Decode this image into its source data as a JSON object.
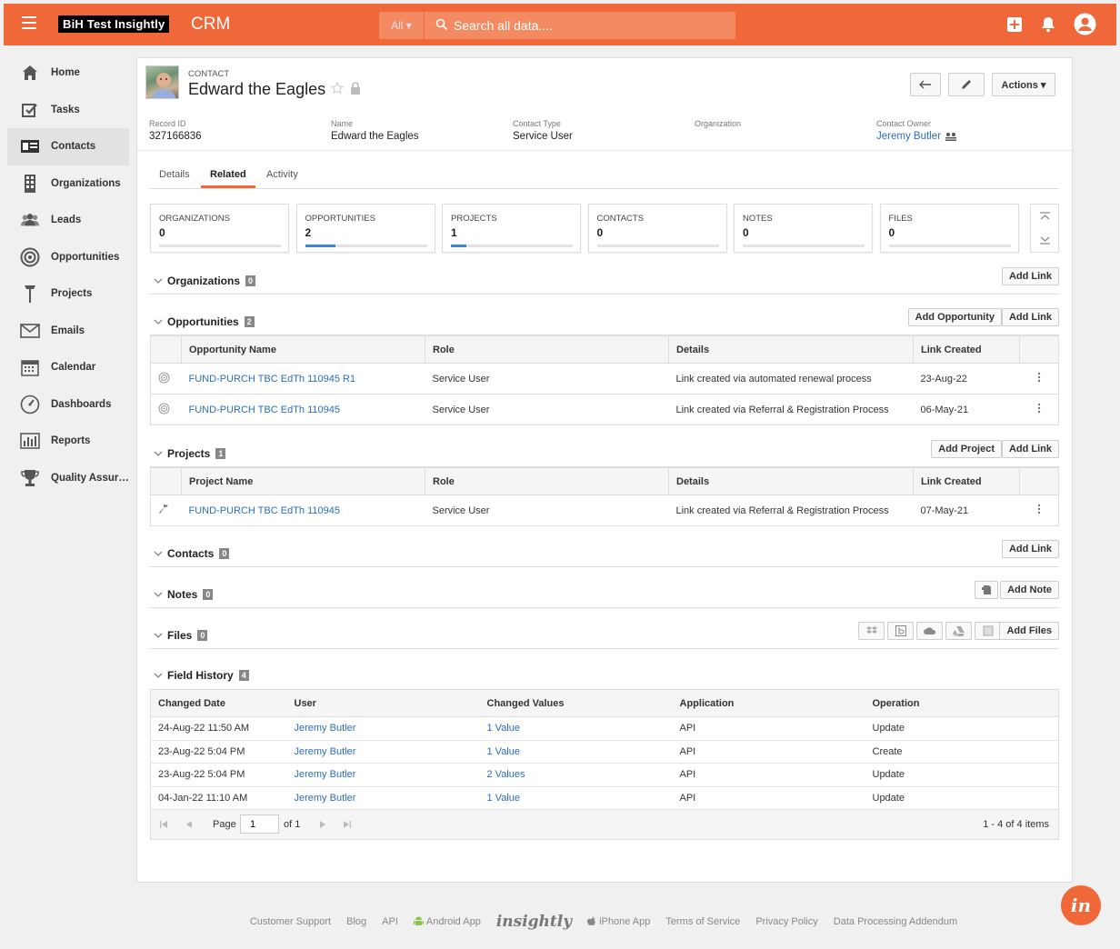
{
  "topbar": {
    "brand": "BiH Test Insightly",
    "app": "CRM",
    "search_scope": "All ▾",
    "search_placeholder": "Search all data...."
  },
  "sidebar": {
    "items": [
      {
        "label": "Home",
        "icon": "home-icon"
      },
      {
        "label": "Tasks",
        "icon": "tasks-icon"
      },
      {
        "label": "Contacts",
        "icon": "contacts-icon"
      },
      {
        "label": "Organizations",
        "icon": "organizations-icon"
      },
      {
        "label": "Leads",
        "icon": "leads-icon"
      },
      {
        "label": "Opportunities",
        "icon": "opportunities-icon"
      },
      {
        "label": "Projects",
        "icon": "projects-icon"
      },
      {
        "label": "Emails",
        "icon": "emails-icon"
      },
      {
        "label": "Calendar",
        "icon": "calendar-icon"
      },
      {
        "label": "Dashboards",
        "icon": "dashboards-icon"
      },
      {
        "label": "Reports",
        "icon": "reports-icon"
      },
      {
        "label": "Quality Assura...",
        "icon": "trophy-icon"
      }
    ],
    "active": "Contacts"
  },
  "record": {
    "type": "CONTACT",
    "name": "Edward the Eagles",
    "actions_label": "Actions ▾",
    "fields": [
      {
        "label": "Record ID",
        "value": "327166836"
      },
      {
        "label": "Name",
        "value": "Edward the Eagles"
      },
      {
        "label": "Contact Type",
        "value": "Service User"
      },
      {
        "label": "Organization",
        "value": ""
      },
      {
        "label": "Contact Owner",
        "value": "Jeremy Butler"
      }
    ]
  },
  "tabs": [
    "Details",
    "Related",
    "Activity"
  ],
  "active_tab": "Related",
  "cards": [
    {
      "label": "ORGANIZATIONS",
      "count": "0",
      "fill": 0
    },
    {
      "label": "OPPORTUNITIES",
      "count": "2",
      "fill": 0.25
    },
    {
      "label": "PROJECTS",
      "count": "1",
      "fill": 0.13
    },
    {
      "label": "CONTACTS",
      "count": "0",
      "fill": 0
    },
    {
      "label": "NOTES",
      "count": "0",
      "fill": 0
    },
    {
      "label": "FILES",
      "count": "0",
      "fill": 0
    }
  ],
  "sections": {
    "organizations": {
      "title": "Organizations",
      "count": "0",
      "add_link": "Add Link"
    },
    "opportunities": {
      "title": "Opportunities",
      "count": "2",
      "add_primary": "Add Opportunity",
      "add_link": "Add Link",
      "headers": [
        "Opportunity Name",
        "Role",
        "Details",
        "Link Created"
      ],
      "rows": [
        {
          "name": "FUND-PURCH TBC EdTh 110945 R1",
          "role": "Service User",
          "details": "Link created via automated renewal process",
          "created": "23-Aug-22"
        },
        {
          "name": "FUND-PURCH TBC EdTh 110945",
          "role": "Service User",
          "details": "Link created via Referral & Registration Process",
          "created": "06-May-21"
        }
      ]
    },
    "projects": {
      "title": "Projects",
      "count": "1",
      "add_primary": "Add Project",
      "add_link": "Add Link",
      "headers": [
        "Project Name",
        "Role",
        "Details",
        "Link Created"
      ],
      "rows": [
        {
          "name": "FUND-PURCH TBC EdTh 110945",
          "role": "Service User",
          "details": "Link created via Referral & Registration Process",
          "created": "07-May-21"
        }
      ]
    },
    "contacts": {
      "title": "Contacts",
      "count": "0",
      "add_link": "Add Link"
    },
    "notes": {
      "title": "Notes",
      "count": "0",
      "add_note": "Add Note"
    },
    "files": {
      "title": "Files",
      "count": "0",
      "add_files": "Add Files"
    },
    "history": {
      "title": "Field History",
      "count": "4",
      "headers": [
        "Changed Date",
        "User",
        "Changed Values",
        "Application",
        "Operation"
      ],
      "rows": [
        {
          "date": "24-Aug-22 11:50 AM",
          "user": "Jeremy Butler",
          "values": "1 Value",
          "app": "API",
          "op": "Update"
        },
        {
          "date": "23-Aug-22 5:04 PM",
          "user": "Jeremy Butler",
          "values": "1 Value",
          "app": "API",
          "op": "Create"
        },
        {
          "date": "23-Aug-22 5:04 PM",
          "user": "Jeremy Butler",
          "values": "2 Values",
          "app": "API",
          "op": "Update"
        },
        {
          "date": "04-Jan-22 11:10 AM",
          "user": "Jeremy Butler",
          "values": "1 Value",
          "app": "API",
          "op": "Update"
        }
      ],
      "page_label": "Page",
      "page_value": "1",
      "page_of": "of 1",
      "items_summary": "1 - 4 of 4 items"
    }
  },
  "footer": {
    "links": [
      "Customer Support",
      "Blog",
      "API",
      "Android App",
      "iPhone App",
      "Terms of Service",
      "Privacy Policy",
      "Data Processing Addendum"
    ],
    "logo": "insightly"
  },
  "badge": "in",
  "colors": {
    "brand": "#f0673a",
    "link": "#2a6ebb",
    "progress": "#3b86dd"
  }
}
